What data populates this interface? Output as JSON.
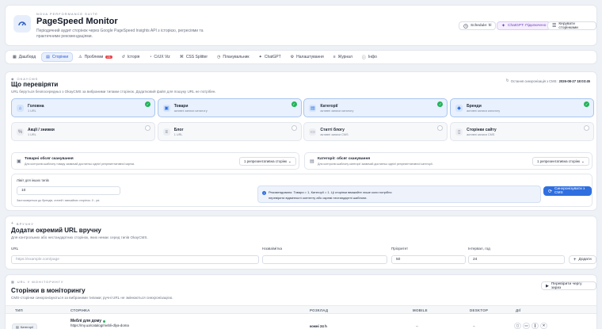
{
  "header": {
    "suite": "NOVA PERFORMANCE SUITE",
    "title": "PageSpeed Monitor",
    "desc1": "Періодичний аудит сторінок через Google PageSpeed Insights API з історією, регресіями та",
    "desc2": "практичними рекомендаціями.",
    "btn_schedule": "Schedule: hl",
    "btn_chatgpt": "ChatGPT: Підключено",
    "btn_manage": "Керувати сторінками"
  },
  "tabs": [
    {
      "label": "Дашборд",
      "icon": "dashboard-icon"
    },
    {
      "label": "Сторінки",
      "icon": "pages-icon"
    },
    {
      "label": "Проблеми",
      "icon": "issues-icon",
      "badge": "21"
    },
    {
      "label": "Історія",
      "icon": "history-icon"
    },
    {
      "label": "CrUX Viz",
      "icon": "crux-icon"
    },
    {
      "label": "CSS Splitter",
      "icon": "css-icon"
    },
    {
      "label": "Планувальник",
      "icon": "scheduler-icon"
    },
    {
      "label": "ChatGPT",
      "icon": "chatgpt-icon"
    },
    {
      "label": "Налаштування",
      "icon": "settings-icon"
    },
    {
      "label": "Журнал",
      "icon": "log-icon"
    },
    {
      "label": "Інфо",
      "icon": "info-icon"
    }
  ],
  "okay": {
    "label": "OKAYCMS",
    "title": "Що перевіряти",
    "desc": "URL беруться безпосередньо з OkayCMS за вибраними типами сторінок. Додатковий файл для пошуку URL не потрібен.",
    "sync_prefix": "Остання синхронізація з CMS:",
    "sync_time": "2026-08-27 18:03:45",
    "options": [
      {
        "title": "Головна",
        "sub": "1 URL",
        "selected": true,
        "color": "#2f6fe0",
        "glyph": "⌂"
      },
      {
        "title": "Товари",
        "sub": "активні записи каталогу",
        "selected": true,
        "color": "#2f6fe0",
        "glyph": "▣"
      },
      {
        "title": "Категорії",
        "sub": "активні записи каталогу",
        "selected": true,
        "color": "#2f6fe0",
        "glyph": "▤"
      },
      {
        "title": "Бренди",
        "sub": "активні записи каталогу",
        "selected": true,
        "color": "#2f6fe0",
        "glyph": "◆"
      },
      {
        "title": "Акції / знижки",
        "sub": "1 URL",
        "selected": false,
        "color": "#6b7485",
        "glyph": "%"
      },
      {
        "title": "Блог",
        "sub": "1 URL",
        "selected": false,
        "color": "#6b7485",
        "glyph": "≡"
      },
      {
        "title": "Статті блогу",
        "sub": "активні записи CMS",
        "selected": false,
        "color": "#6b7485",
        "glyph": "▭"
      },
      {
        "title": "Сторінки сайту",
        "sub": "активні записи CMS",
        "selected": false,
        "color": "#6b7485",
        "glyph": "▯"
      }
    ],
    "scope_products": {
      "title": "Товарні обсяг сканування",
      "sub": "Для контролю шаблону товару зазвичай достатньо однієї репрезентативної картки.",
      "value": "1 репрезентативна сторінк"
    },
    "scope_categories": {
      "title": "Категорії: обсяг сканування",
      "sub": "Для контролю шаблону категорії зазвичай достатньо однієї репрезентативної категорії.",
      "value": "1 репрезентативна сторінк"
    },
    "limit_label": "Ліміт для інших типів",
    "limit_value": "10",
    "limit_hint": "Застосовується до брендів, статей і звичайних сторінок. 0 - усі.",
    "info_text1": "Рекомендовано: Товари = 1, Категорії = 1. Ці сторінки вважайте лише коли потрібно",
    "info_text2": "перевірити відмінності контенту або окремі нестандартні шаблони.",
    "sync_btn": "Синхронізувати з CMS"
  },
  "manual": {
    "label": "ВРУЧНУ",
    "title": "Додати окремий URL вручну",
    "desc": "Для контрольних або нестандартних сторінок, яких немає серед типів OkayCMS.",
    "url_label": "URL",
    "url_placeholder": "https://example.com/page",
    "name_label": "Назва/мітка",
    "priority_label": "Пріоритет",
    "priority_value": "50",
    "interval_label": "Інтервал, год",
    "interval_value": "24",
    "add_btn": "Додати"
  },
  "monitor": {
    "label": "URL У МОНІТОРИНГУ",
    "title": "Сторінки в моніторингу",
    "desc": "CMS-сторінки синхронізуються за вибраними типами; ручні URL не змінюються синхронізацією.",
    "check_btn": "Перевірити чергу зараз",
    "columns": [
      "ТИП",
      "СТОРІНКА",
      "РОЗКЛАД",
      "MOBILE",
      "DESKTOP",
      "ДІЇ"
    ],
    "row": {
      "type": "Категорії",
      "name": "Меблі для дому",
      "url": "https://my.ua/catalog/mebli-dlya-doma",
      "schedule": "кожні 24 h"
    }
  }
}
